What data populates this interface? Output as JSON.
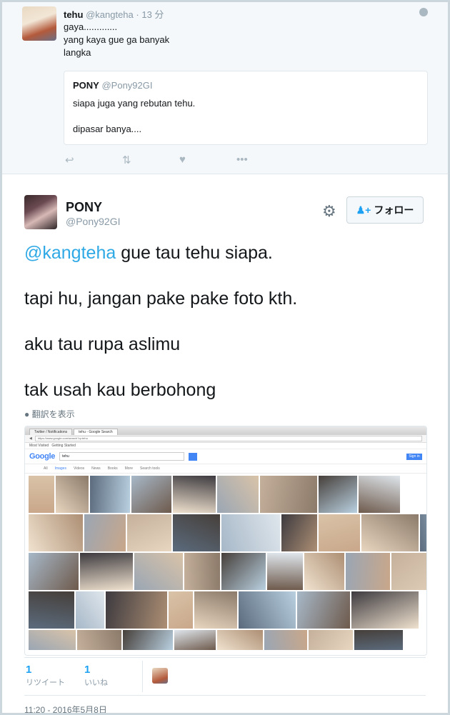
{
  "reply": {
    "name": "tehu",
    "handle": "@kangteha",
    "time": "· 13 分",
    "text": "gaya.............\nyang kaya gue ga banyak\nlangka",
    "quote": {
      "name": "PONY",
      "handle": "@Pony92GI",
      "text": "siapa juga yang rebutan tehu.\n\ndipasar banya...."
    },
    "actions": [
      "reply-icon",
      "retweet-icon",
      "like-icon",
      "more-icon"
    ]
  },
  "tweet": {
    "name": "PONY",
    "handle": "@Pony92GI",
    "follow_label": "フォロー",
    "mention": "@kangteha",
    "line1_rest": " gue tau tehu siapa.",
    "line2": "tapi hu, jangan pake pake foto kth.",
    "line3": "aku tau rupa aslimu",
    "line4": "tak usah kau berbohong",
    "translate": "翻訳を表示"
  },
  "screenshot": {
    "tab1": "Twitter / Notifications",
    "tab2": "tehu - Google Search",
    "url": "https://www.google.com/search?q=tehu",
    "bookmark1": "Most Visited",
    "bookmark2": "Getting Started",
    "logo": "Google",
    "query": "tehu",
    "sign_in": "Sign in",
    "tabs": [
      "All",
      "Images",
      "Videos",
      "News",
      "Books",
      "More",
      "Search tools"
    ]
  },
  "stats": {
    "retweets": "1",
    "retweets_label": "リツイート",
    "likes": "1",
    "likes_label": "いいね"
  },
  "timestamp": "11:20 - 2016年5月8日"
}
